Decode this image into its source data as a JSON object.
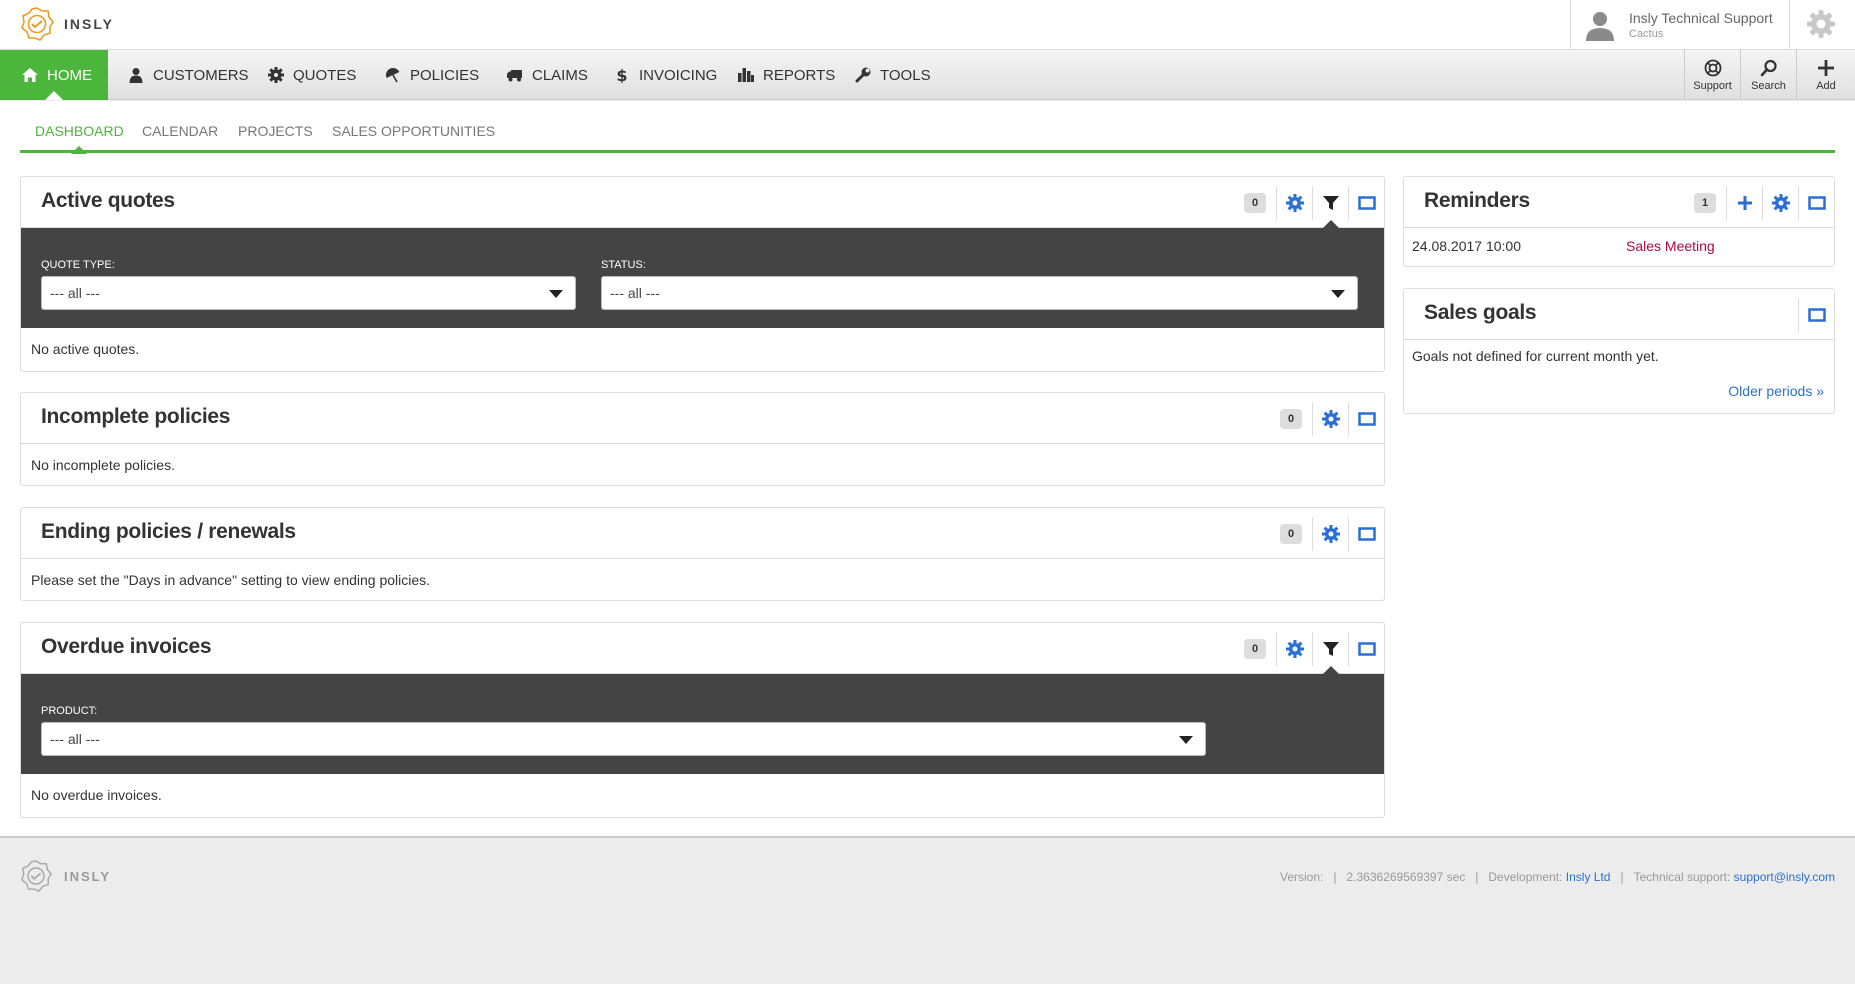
{
  "brand": {
    "name": "INSLY"
  },
  "user": {
    "name": "Insly Technical Support",
    "org": "Cactus"
  },
  "colors": {
    "accent": "#4cb53c",
    "link": "#2a6fd6",
    "reminder": "#b5063e",
    "filterbar": "#444444"
  },
  "nav": {
    "items": [
      {
        "label": "HOME",
        "icon": "home-icon",
        "active": true
      },
      {
        "label": "CUSTOMERS",
        "icon": "user-icon"
      },
      {
        "label": "QUOTES",
        "icon": "cog-icon"
      },
      {
        "label": "POLICIES",
        "icon": "umbrella-icon"
      },
      {
        "label": "CLAIMS",
        "icon": "truck-icon"
      },
      {
        "label": "INVOICING",
        "icon": "dollar-icon"
      },
      {
        "label": "REPORTS",
        "icon": "bar-chart-icon"
      },
      {
        "label": "TOOLS",
        "icon": "wrench-icon"
      }
    ],
    "right": [
      {
        "label": "Support",
        "icon": "lifebuoy-icon"
      },
      {
        "label": "Search",
        "icon": "search-icon"
      },
      {
        "label": "Add",
        "icon": "plus-icon"
      }
    ]
  },
  "subnav": [
    "DASHBOARD",
    "CALENDAR",
    "PROJECTS",
    "SALES OPPORTUNITIES"
  ],
  "panels": {
    "active_quotes": {
      "title": "Active quotes",
      "count": "0",
      "filters": [
        {
          "label": "QUOTE TYPE:",
          "value": "--- all ---"
        },
        {
          "label": "STATUS:",
          "value": "--- all ---"
        }
      ],
      "empty": "No active quotes."
    },
    "incomplete_policies": {
      "title": "Incomplete policies",
      "count": "0",
      "empty": "No incomplete policies."
    },
    "ending_policies": {
      "title": "Ending policies / renewals",
      "count": "0",
      "empty": "Please set the \"Days in advance\" setting to view ending policies."
    },
    "overdue_invoices": {
      "title": "Overdue invoices",
      "count": "0",
      "filters": [
        {
          "label": "PRODUCT:",
          "value": "--- all ---"
        }
      ],
      "empty": "No overdue invoices."
    },
    "reminders": {
      "title": "Reminders",
      "count": "1",
      "items": [
        {
          "date": "24.08.2017 10:00",
          "title": "Sales Meeting"
        }
      ]
    },
    "sales_goals": {
      "title": "Sales goals",
      "text": "Goals not defined for current month yet.",
      "link": "Older periods »"
    }
  },
  "footer": {
    "version_label": "Version:",
    "time": "2.3636269569397 sec",
    "dev_label": "Development:",
    "dev_link": "Insly Ltd",
    "support_label": "Technical support:",
    "support_link": "support@insly.com"
  }
}
